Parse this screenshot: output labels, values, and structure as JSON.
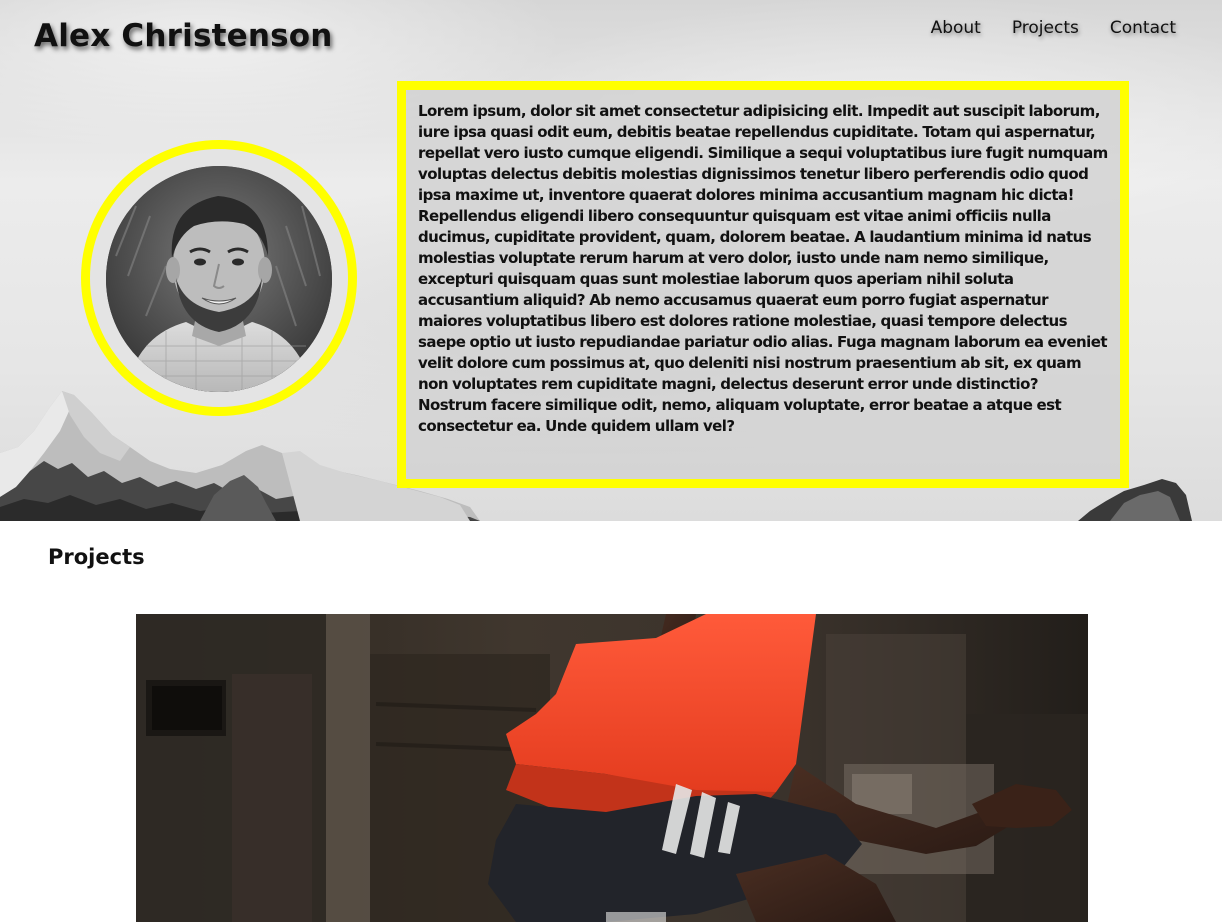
{
  "header": {
    "site_title": "Alex Christenson",
    "nav": [
      "About",
      "Projects",
      "Contact"
    ]
  },
  "about": {
    "bio": "Lorem ipsum, dolor sit amet consectetur adipisicing elit. Impedit aut suscipit laborum, iure ipsa quasi odit eum, debitis beatae repellendus cupiditate. Totam qui aspernatur, repellat vero iusto cumque eligendi. Similique a sequi voluptatibus iure fugit numquam voluptas delectus debitis molestias dignissimos tenetur libero perferendis odio quod ipsa maxime ut, inventore quaerat dolores minima accusantium magnam hic dicta! Repellendus eligendi libero consequuntur quisquam est vitae animi officiis nulla ducimus, cupiditate provident, quam, dolorem beatae. A laudantium minima id natus molestias voluptate rerum harum at vero dolor, iusto unde nam nemo similique, excepturi quisquam quas sunt molestiae laborum quos aperiam nihil soluta accusantium aliquid? Ab nemo accusamus quaerat eum porro fugiat aspernatur maiores voluptatibus libero est dolores ratione molestiae, quasi tempore delectus saepe optio ut iusto repudiandae pariatur odio alias. Fuga magnam laborum ea eveniet velit dolore cum possimus at, quo deleniti nisi nostrum praesentium ab sit, ex quam non voluptates rem cupiditate magni, delectus deserunt error unde distinctio? Nostrum facere similique odit, nemo, aliquam voluptate, error beatae a atque est consectetur ea. Unde quidem ullam vel?"
  },
  "projects": {
    "heading": "Projects"
  },
  "colors": {
    "accent": "#ffff00",
    "text": "#111111"
  }
}
